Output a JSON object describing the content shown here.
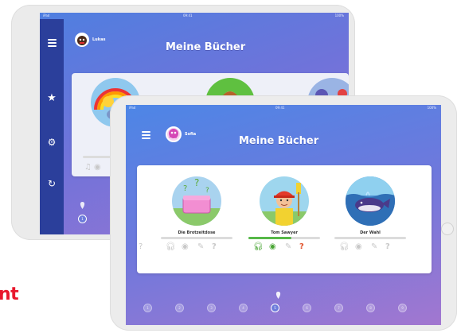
{
  "back_tablet": {
    "statusbar": {
      "left": "iPad",
      "center": "09:41",
      "right": "100%"
    },
    "user": {
      "name": "Lukas"
    },
    "title": "Meine Bücher",
    "sidebar": {
      "menu_icon": "hamburger-icon",
      "items": [
        {
          "icon": "star-icon"
        },
        {
          "icon": "gear-icon"
        },
        {
          "icon": "refresh-icon"
        }
      ]
    },
    "pager": {
      "current": "1"
    }
  },
  "front_tablet": {
    "statusbar": {
      "left": "iPad",
      "center": "09:41",
      "right": "100%"
    },
    "user": {
      "name": "Sofia"
    },
    "title": "Meine Bücher",
    "books": [
      {
        "title": "Die Brotzeitdose",
        "progress": 0.0,
        "cover_color": "#6fb0d8"
      },
      {
        "title": "Tom Sawyer",
        "progress": 0.6,
        "cover_color": "#8fd0ea"
      },
      {
        "title": "Der Wahl",
        "progress": 0.0,
        "cover_color": "#3a7fc2"
      }
    ],
    "activities": [
      "headphones-icon",
      "eye-icon",
      "pen-icon",
      "question-icon"
    ],
    "activity_colors": {
      "active": "#4aa536",
      "question_active": "#e0522b",
      "inactive": "#c8c8c8"
    },
    "pager": {
      "pages": [
        "1",
        "2",
        "3",
        "4",
        "5",
        "6",
        "7",
        "8",
        "9"
      ],
      "current_index": 4
    }
  },
  "edge_word": "nt"
}
